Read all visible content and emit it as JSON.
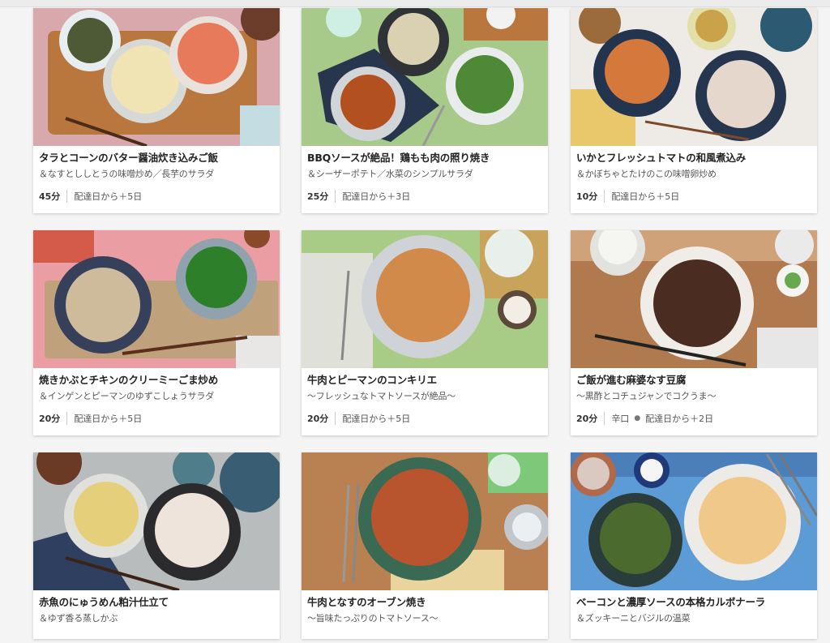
{
  "recipes": [
    {
      "title": "タラとコーンのバター醤油炊き込みご飯",
      "subtitle": "＆なすとししとうの味噌炒め／長芋のサラダ",
      "time": "45分",
      "tag": "",
      "delivery": "配達日から＋5日"
    },
    {
      "title": "BBQソースが絶品！鶏もも肉の照り焼き",
      "subtitle": "＆シーザーポテト／水菜のシンプルサラダ",
      "time": "25分",
      "tag": "",
      "delivery": "配達日から＋3日"
    },
    {
      "title": "いかとフレッシュトマトの和風煮込み",
      "subtitle": "＆かぼちゃとたけのこの味噌卵炒め",
      "time": "10分",
      "tag": "",
      "delivery": "配達日から＋5日"
    },
    {
      "title": "焼きかぶとチキンのクリーミーごま炒め",
      "subtitle": "＆インゲンとピーマンのゆずこしょうサラダ",
      "time": "20分",
      "tag": "",
      "delivery": "配達日から＋5日"
    },
    {
      "title": "牛肉とピーマンのコンキリエ",
      "subtitle": "〜フレッシュなトマトソースが絶品〜",
      "time": "20分",
      "tag": "",
      "delivery": "配達日から＋5日"
    },
    {
      "title": "ご飯が進む麻婆なす豆腐",
      "subtitle": "〜黒酢とコチュジャンでコクうま〜",
      "time": "20分",
      "tag": "辛口",
      "delivery": "配達日から＋2日"
    },
    {
      "title": "赤魚のにゅうめん粕汁仕立て",
      "subtitle": "＆ゆず香る蒸しかぶ",
      "time": "",
      "tag": "",
      "delivery": ""
    },
    {
      "title": "牛肉となすのオーブン焼き",
      "subtitle": "〜旨味たっぷりのトマトソース〜",
      "time": "",
      "tag": "",
      "delivery": ""
    },
    {
      "title": "ベーコンと濃厚ソースの本格カルボナーラ",
      "subtitle": "＆ズッキーニとバジルの温菜",
      "time": "",
      "tag": "",
      "delivery": ""
    }
  ],
  "colors": {
    "card_bg": "#ffffff",
    "page_bg": "#f4f4f4",
    "title_text": "#222222"
  }
}
